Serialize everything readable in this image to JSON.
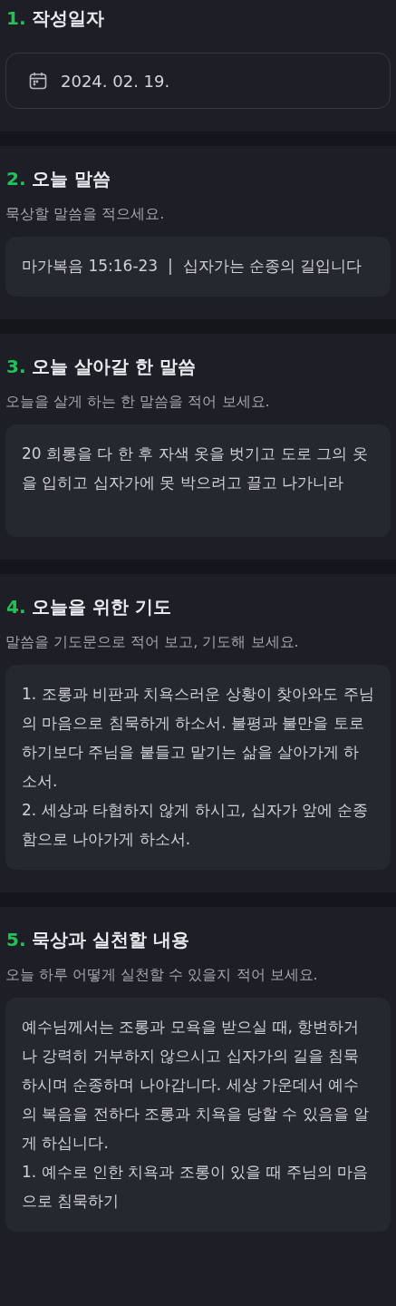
{
  "sections": [
    {
      "number": "1.",
      "title": "작성일자",
      "kind": "date",
      "value": "2024. 02. 19."
    },
    {
      "number": "2.",
      "title": "오늘 말씀",
      "description": "묵상할 말씀을 적으세요.",
      "kind": "text",
      "value": "마가복음 15:16-23  |  십자가는 순종의 길입니다"
    },
    {
      "number": "3.",
      "title": "오늘 살아갈 한 말씀",
      "description": "오늘을 살게 하는 한 말씀을 적어 보세요.",
      "kind": "text",
      "value": "20 희롱을 다 한 후 자색 옷을 벗기고 도로 그의 옷을 입히고 십자가에 못 박으려고 끌고 나가니라"
    },
    {
      "number": "4.",
      "title": "오늘을 위한 기도",
      "description": "말씀을 기도문으로 적어 보고, 기도해 보세요.",
      "kind": "text",
      "value": "1. 조롱과 비판과 치욕스러운 상황이 찾아와도 주님의 마음으로 침묵하게 하소서. 불평과 불만을 토로하기보다 주님을 붙들고 맡기는 삶을 살아가게 하소서.\n2. 세상과 타협하지 않게 하시고, 십자가 앞에 순종함으로 나아가게 하소서."
    },
    {
      "number": "5.",
      "title": "묵상과 실천할 내용",
      "description": "오늘 하루 어떻게 실천할 수 있을지 적어 보세요.",
      "kind": "text",
      "value": "예수님께서는 조롱과 모욕을 받으실 때, 항변하거나 강력히 거부하지 않으시고 십자가의 길을 침묵하시며 순종하며 나아갑니다. 세상 가운데서 예수의 복음을 전하다 조롱과 치욕을 당할 수 있음을 알게 하십니다.\n1. 예수로 인한 치욕과 조롱이 있을 때 주님의 마음으로 침묵하기"
    }
  ]
}
